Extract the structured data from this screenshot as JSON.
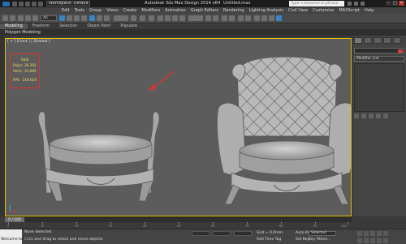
{
  "window": {
    "workspace_label": "Workspace: Default",
    "title": "Autodesk 3ds Max Design 2014 x64",
    "file_name": "Untitled.max",
    "search_placeholder": "Type a keyword or phrase",
    "window_controls": [
      "–",
      "□",
      "✕"
    ]
  },
  "menu": [
    "Edit",
    "Tools",
    "Group",
    "Views",
    "Create",
    "Modifiers",
    "Animation",
    "Graph Editors",
    "Rendering",
    "Lighting Analysis",
    "Civil View",
    "Customize",
    "MAXScript",
    "Help"
  ],
  "toolbar": {
    "selection_filter": "All"
  },
  "ribbon": {
    "tabs": [
      "Modeling",
      "Freeform",
      "Selection",
      "Object Paint",
      "Populate"
    ],
    "active_tab": "Modeling",
    "sub_label": "Polygon Modeling"
  },
  "viewport": {
    "label": "[ + ] [Front ] [ Shaded ]",
    "stats": {
      "header": "Total",
      "rows": [
        {
          "key": "Polys:",
          "value": "30,392"
        },
        {
          "key": "Verts:",
          "value": "31,085"
        },
        {
          "key": "FPS:",
          "value": "119.024"
        }
      ]
    },
    "annotation_color": "#e03030"
  },
  "command_panel": {
    "modifier_list": "Modifier List",
    "object_color": "#e03a3a"
  },
  "timeline": {
    "slider": "0 / 100",
    "ticks": [
      "0",
      "10",
      "20",
      "30",
      "40",
      "50",
      "60",
      "70",
      "80",
      "90",
      "100"
    ]
  },
  "status": {
    "maxscript": "Welcome to MAX",
    "selection": "None Selected",
    "prompt": "Click and drag to select and move objects",
    "grid": "Grid = 0.0mm",
    "time_tag": "Add Time Tag",
    "auto_key": "Auto Key",
    "set_key": "Set Key",
    "selected_dropdown": "Selected",
    "key_filters": "Key Filters..."
  }
}
